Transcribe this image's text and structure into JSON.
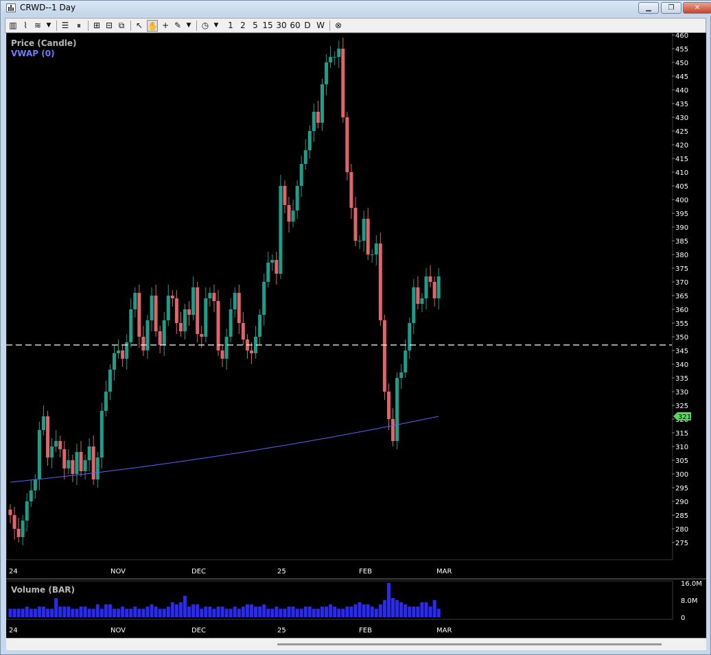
{
  "window": {
    "title": "CRWD--1 Day",
    "minimize_label": "▁",
    "restore_label": "❐",
    "close_label": "✕"
  },
  "toolbar": {
    "icons": [
      "bar-chart-icon",
      "line-chart-icon",
      "chart-style-icon",
      "dropdown-icon",
      "horizontal-lines-icon",
      "vertical-lines-icon",
      "zoom-in-icon",
      "zoom-out-icon",
      "zoom-fit-icon",
      "pointer-icon",
      "hand-icon",
      "crosshair-icon",
      "draw-pencil-icon",
      "dropdown-icon",
      "clock-icon",
      "dropdown-icon"
    ],
    "intervals": [
      "1",
      "2",
      "5",
      "15",
      "30",
      "60",
      "D",
      "W"
    ],
    "cancel_icon": "cancel-circle-icon"
  },
  "legend": {
    "price": "Price (Candle)",
    "vwap": "VWAP (0)",
    "volume": "Volume (BAR)"
  },
  "colors": {
    "up": "#1e9e8a",
    "down": "#e06468",
    "vwap": "#5a62ff",
    "volume": "#2a2af0",
    "grid": "#2a2a2a",
    "axis_text": "#ffffff"
  },
  "chart_data": {
    "type": "candlestick",
    "y_axis": {
      "min": 270,
      "max": 460,
      "ticks": [
        275,
        280,
        285,
        290,
        295,
        300,
        305,
        310,
        315,
        320,
        325,
        330,
        335,
        340,
        345,
        350,
        355,
        360,
        365,
        370,
        375,
        380,
        385,
        390,
        395,
        400,
        405,
        410,
        415,
        420,
        425,
        430,
        435,
        440,
        445,
        450,
        455,
        460
      ]
    },
    "x_labels": [
      "24",
      "NOV",
      "DEC",
      "25",
      "FEB",
      "MAR"
    ],
    "horizontal_line": 347,
    "last_price_label": "321",
    "closes": [
      285,
      280,
      277,
      283,
      290,
      294,
      298,
      316,
      321,
      306,
      310,
      312,
      309,
      302,
      305,
      300,
      308,
      301,
      305,
      310,
      298,
      306,
      323,
      330,
      338,
      344,
      345,
      342,
      348,
      360,
      366,
      350,
      345,
      356,
      365,
      352,
      347,
      356,
      365,
      364,
      355,
      352,
      360,
      358,
      368,
      351,
      350,
      364,
      366,
      363,
      345,
      342,
      350,
      360,
      366,
      355,
      349,
      345,
      344,
      350,
      358,
      370,
      377,
      378,
      373,
      405,
      398,
      392,
      396,
      405,
      413,
      418,
      425,
      432,
      428,
      442,
      450,
      452,
      452,
      455,
      430,
      410,
      397,
      385,
      385,
      393,
      380,
      380,
      384,
      356,
      330,
      320,
      312,
      335,
      337,
      345,
      355,
      368,
      362,
      364,
      372,
      370,
      364,
      372
    ],
    "volume": {
      "ticks": [
        "16.0M",
        "8.0M",
        "0"
      ],
      "max": 16.0,
      "values_m": [
        4,
        4,
        4,
        4,
        5,
        4,
        4,
        5,
        5,
        4,
        4,
        9,
        5,
        5,
        5,
        4,
        4,
        5,
        5,
        4,
        4,
        6,
        4,
        6,
        6,
        4,
        4,
        5,
        4,
        4,
        5,
        4,
        4,
        5,
        6,
        5,
        4,
        4,
        5,
        7,
        6,
        7,
        10,
        5,
        6,
        6,
        4,
        5,
        5,
        4,
        5,
        5,
        4,
        4,
        5,
        4,
        5,
        6,
        6,
        5,
        5,
        6,
        4,
        4,
        5,
        4,
        4,
        5,
        5,
        4,
        4,
        5,
        5,
        4,
        4,
        5,
        5,
        6,
        5,
        4,
        4,
        5,
        5,
        6,
        7,
        6,
        6,
        5,
        4,
        6,
        8,
        16,
        9,
        8,
        7,
        6,
        5,
        5,
        5,
        7,
        7,
        5,
        8,
        4
      ]
    },
    "vwap_start": 297,
    "vwap_end": 321
  }
}
